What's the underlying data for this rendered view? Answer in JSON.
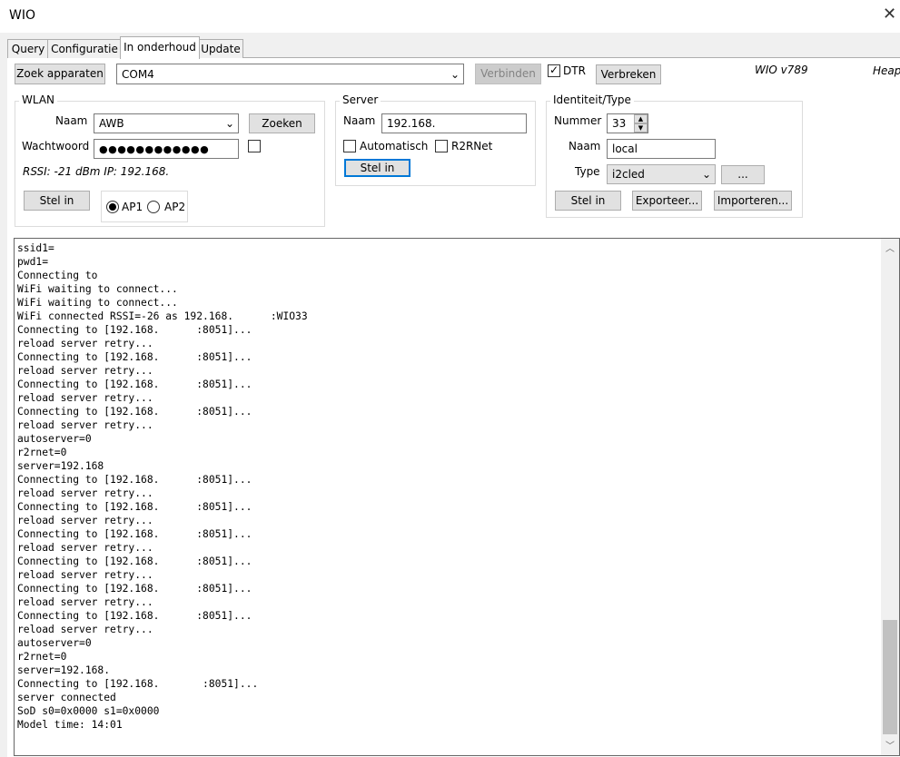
{
  "window": {
    "title": "WIO",
    "close_glyph": "✕"
  },
  "tabs": [
    "Query",
    "Configuratie",
    "In onderhoud",
    "Update"
  ],
  "toolbar": {
    "search_devices": "Zoek apparaten",
    "port": "COM4",
    "connect": "Verbinden",
    "dtr_label": "DTR",
    "disconnect": "Verbreken",
    "version": "WIO v789",
    "heap": "Heap"
  },
  "wlan": {
    "legend": "WLAN",
    "name_label": "Naam",
    "name_value": "AWB",
    "search_button": "Zoeken",
    "password_label": "Wachtwoord",
    "password_value": "●●●●●●●●●●●●",
    "rssi_text": "RSSI: -21  dBm  IP: 192.168.",
    "apply_button": "Stel in",
    "ap1": "AP1",
    "ap2": "AP2"
  },
  "server": {
    "legend": "Server",
    "name_label": "Naam",
    "name_value": "192.168.",
    "auto_label": "Automatisch",
    "r2r_label": "R2RNet",
    "apply_button": "Stel in"
  },
  "identity": {
    "legend": "Identiteit/Type",
    "number_label": "Nummer",
    "number_value": "33",
    "name_label": "Naam",
    "name_value": "local",
    "type_label": "Type",
    "type_value": "i2cled",
    "more_button": "...",
    "apply_button": "Stel in",
    "export_button": "Exporteer...",
    "import_button": "Importeren..."
  },
  "console_log": "ssid1=\npwd1=\nConnecting to\nWiFi waiting to connect...\nWiFi waiting to connect...\nWiFi connected RSSI=-26 as 192.168.      :WIO33\nConnecting to [192.168.      :8051]...\nreload server retry...\nConnecting to [192.168.      :8051]...\nreload server retry...\nConnecting to [192.168.      :8051]...\nreload server retry...\nConnecting to [192.168.      :8051]...\nreload server retry...\nautoserver=0\nr2rnet=0\nserver=192.168\nConnecting to [192.168.      :8051]...\nreload server retry...\nConnecting to [192.168.      :8051]...\nreload server retry...\nConnecting to [192.168.      :8051]...\nreload server retry...\nConnecting to [192.168.      :8051]...\nreload server retry...\nConnecting to [192.168.      :8051]...\nreload server retry...\nConnecting to [192.168.      :8051]...\nreload server retry...\nautoserver=0\nr2rnet=0\nserver=192.168.\nConnecting to [192.168.       :8051]...\nserver connected\nSoD s0=0x0000 s1=0x0000\nModel time: 14:01",
  "icons": {
    "chevron": "⌄",
    "check": "✓",
    "up": "▲",
    "down": "▼",
    "scroll_up": "︿",
    "scroll_down": "﹀"
  }
}
